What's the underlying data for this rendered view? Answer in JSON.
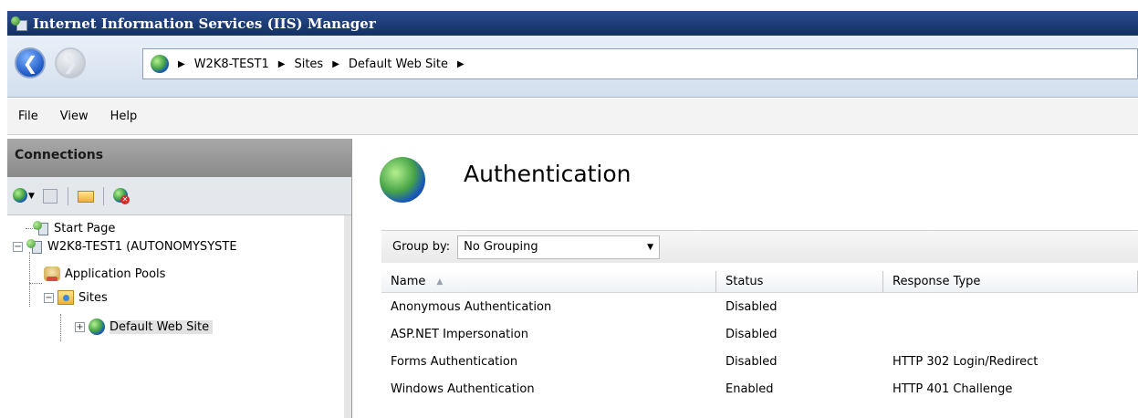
{
  "window": {
    "title": "Internet Information Services (IIS) Manager"
  },
  "address": {
    "crumbs": [
      "W2K8-TEST1",
      "Sites",
      "Default Web Site"
    ]
  },
  "menu": {
    "file": "File",
    "view": "View",
    "help": "Help"
  },
  "connections": {
    "title": "Connections",
    "tree": {
      "start_page": "Start Page",
      "server": "W2K8-TEST1 (AUTONOMYSYSTE",
      "app_pools": "Application Pools",
      "sites": "Sites",
      "default_site": "Default Web Site"
    }
  },
  "feature": {
    "title": "Authentication",
    "group_by_label": "Group by:",
    "group_by_value": "No Grouping",
    "columns": {
      "name": "Name",
      "status": "Status",
      "response_type": "Response Type"
    },
    "rows": [
      {
        "name": "Anonymous Authentication",
        "status": "Disabled",
        "response_type": ""
      },
      {
        "name": "ASP.NET Impersonation",
        "status": "Disabled",
        "response_type": ""
      },
      {
        "name": "Forms Authentication",
        "status": "Disabled",
        "response_type": "HTTP 302 Login/Redirect"
      },
      {
        "name": "Windows Authentication",
        "status": "Enabled",
        "response_type": "HTTP 401 Challenge"
      }
    ]
  }
}
